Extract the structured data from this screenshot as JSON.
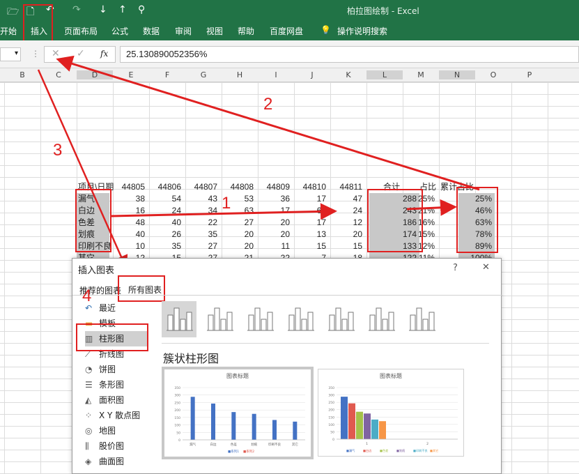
{
  "window": {
    "title": "柏拉图绘制  -  Excel"
  },
  "ribbon": {
    "tabs": [
      "开始",
      "插入",
      "页面布局",
      "公式",
      "数据",
      "审阅",
      "视图",
      "帮助",
      "百度网盘"
    ],
    "search": "操作说明搜索"
  },
  "formula_bar": {
    "fx": "fx",
    "value": "25.130890052356%"
  },
  "columns": [
    "B",
    "C",
    "D",
    "E",
    "F",
    "G",
    "H",
    "I",
    "J",
    "K",
    "L",
    "M",
    "N",
    "O",
    "P"
  ],
  "table": {
    "header": [
      "项目\\日期",
      "44805",
      "44806",
      "44807",
      "44808",
      "44809",
      "44810",
      "44811",
      "合计",
      "占比",
      "累计占比"
    ],
    "rows": [
      [
        "漏气",
        "38",
        "54",
        "43",
        "53",
        "36",
        "17",
        "47",
        "288",
        "25%",
        "25%"
      ],
      [
        "白边",
        "16",
        "24",
        "34",
        "63",
        "17",
        "65",
        "24",
        "243",
        "21%",
        "46%"
      ],
      [
        "色差",
        "48",
        "40",
        "22",
        "27",
        "20",
        "17",
        "12",
        "186",
        "16%",
        "63%"
      ],
      [
        "划痕",
        "40",
        "26",
        "35",
        "20",
        "20",
        "13",
        "20",
        "174",
        "15%",
        "78%"
      ],
      [
        "印刷不良",
        "10",
        "35",
        "27",
        "20",
        "11",
        "15",
        "15",
        "133",
        "12%",
        "89%"
      ],
      [
        "其它",
        "12",
        "15",
        "27",
        "21",
        "22",
        "7",
        "18",
        "122",
        "11%",
        "100%"
      ]
    ]
  },
  "dialog": {
    "title": "插入图表",
    "help": "?",
    "close": "✕",
    "tabs": [
      "推荐的图表",
      "所有图表"
    ],
    "side": [
      {
        "label": "最近",
        "icon": "recent-icon"
      },
      {
        "label": "模板",
        "icon": "folder-icon"
      },
      {
        "label": "柱形图",
        "icon": "column-chart-icon"
      },
      {
        "label": "折线图",
        "icon": "line-chart-icon"
      },
      {
        "label": "饼图",
        "icon": "pie-chart-icon"
      },
      {
        "label": "条形图",
        "icon": "bar-chart-icon"
      },
      {
        "label": "面积图",
        "icon": "area-chart-icon"
      },
      {
        "label": "X Y 散点图",
        "icon": "scatter-chart-icon"
      },
      {
        "label": "地图",
        "icon": "map-chart-icon"
      },
      {
        "label": "股价图",
        "icon": "stock-chart-icon"
      },
      {
        "label": "曲面图",
        "icon": "surface-chart-icon"
      }
    ],
    "heading": "簇状柱形图",
    "preview1": {
      "title": "图表标题",
      "yticks": [
        "350",
        "300",
        "250",
        "200",
        "150",
        "100",
        "50",
        "0"
      ],
      "categories": [
        "漏气",
        "白边",
        "色差",
        "划痕",
        "印刷不良",
        "其它"
      ],
      "values": [
        288,
        243,
        186,
        174,
        133,
        122
      ],
      "legend": [
        "系列1",
        "系列2"
      ]
    },
    "preview2": {
      "title": "图表标题",
      "yticks": [
        "350",
        "300",
        "250",
        "200",
        "150",
        "100",
        "50",
        "0"
      ],
      "categories": [
        "1",
        "2"
      ],
      "values": [
        288,
        243,
        186,
        174,
        133,
        122
      ],
      "colors": [
        "#4472c4",
        "#e05a4f",
        "#a5c24a",
        "#8064a2",
        "#4bacc6",
        "#f79646"
      ],
      "legend": [
        "漏气",
        "白边",
        "色差",
        "划痕",
        "印刷不良",
        "其它"
      ]
    }
  },
  "annotations": [
    "1",
    "2",
    "3",
    "4"
  ]
}
